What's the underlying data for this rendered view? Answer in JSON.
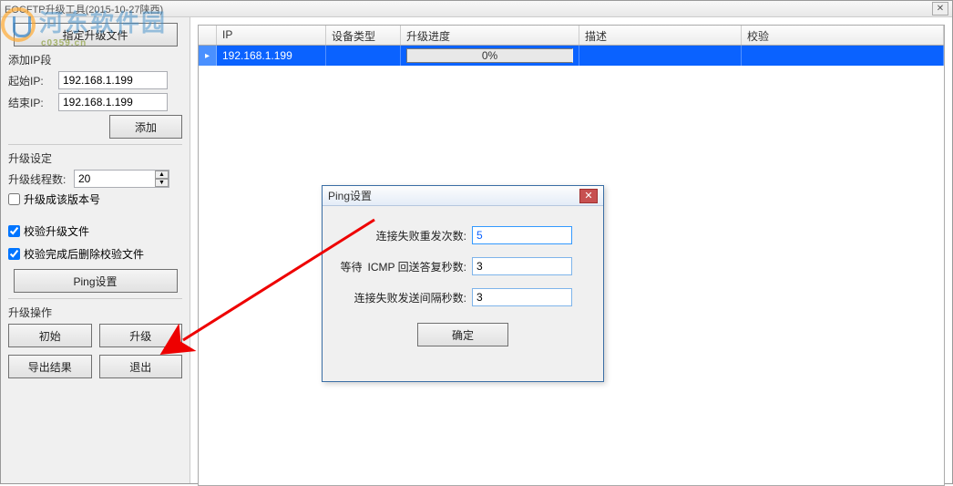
{
  "window": {
    "title": "EOCFTP升级工具(2015-10-27陕西)"
  },
  "watermark": {
    "text": "河东软件园",
    "sub": "c0359.cn"
  },
  "sidebar": {
    "select_file_btn": "指定升级文件",
    "add_ip_legend": "添加IP段",
    "start_ip_label": "起始IP:",
    "start_ip_value": "192.168.1.199",
    "end_ip_label": "结束IP:",
    "end_ip_value": "192.168.1.199",
    "add_btn": "添加",
    "upgrade_setting_legend": "升级设定",
    "thread_label": "升级线程数:",
    "thread_value": "20",
    "ver_checkbox": "升级成该版本号",
    "ver_checked": false,
    "verify_checkbox": "校验升级文件",
    "verify_checked": true,
    "delverify_checkbox": "校验完成后删除校验文件",
    "delverify_checked": true,
    "ping_btn": "Ping设置",
    "upgrade_ops_legend": "升级操作",
    "init_btn": "初始",
    "upgrade_btn": "升级",
    "export_btn": "导出结果",
    "exit_btn": "退出"
  },
  "grid": {
    "headers": {
      "ip": "IP",
      "type": "设备类型",
      "progress": "升级进度",
      "desc": "描述",
      "check": "校验"
    },
    "rows": [
      {
        "ip": "192.168.1.199",
        "type": "",
        "progress": "0%",
        "desc": "",
        "check": ""
      }
    ]
  },
  "dialog": {
    "title": "Ping设置",
    "retry_label": "连接失败重发次数:",
    "retry_value": "5",
    "icmp_label": "等待 ICMP 回送答复秒数:",
    "icmp_value": "3",
    "interval_label": "连接失败发送间隔秒数:",
    "interval_value": "3",
    "ok_btn": "确定"
  }
}
